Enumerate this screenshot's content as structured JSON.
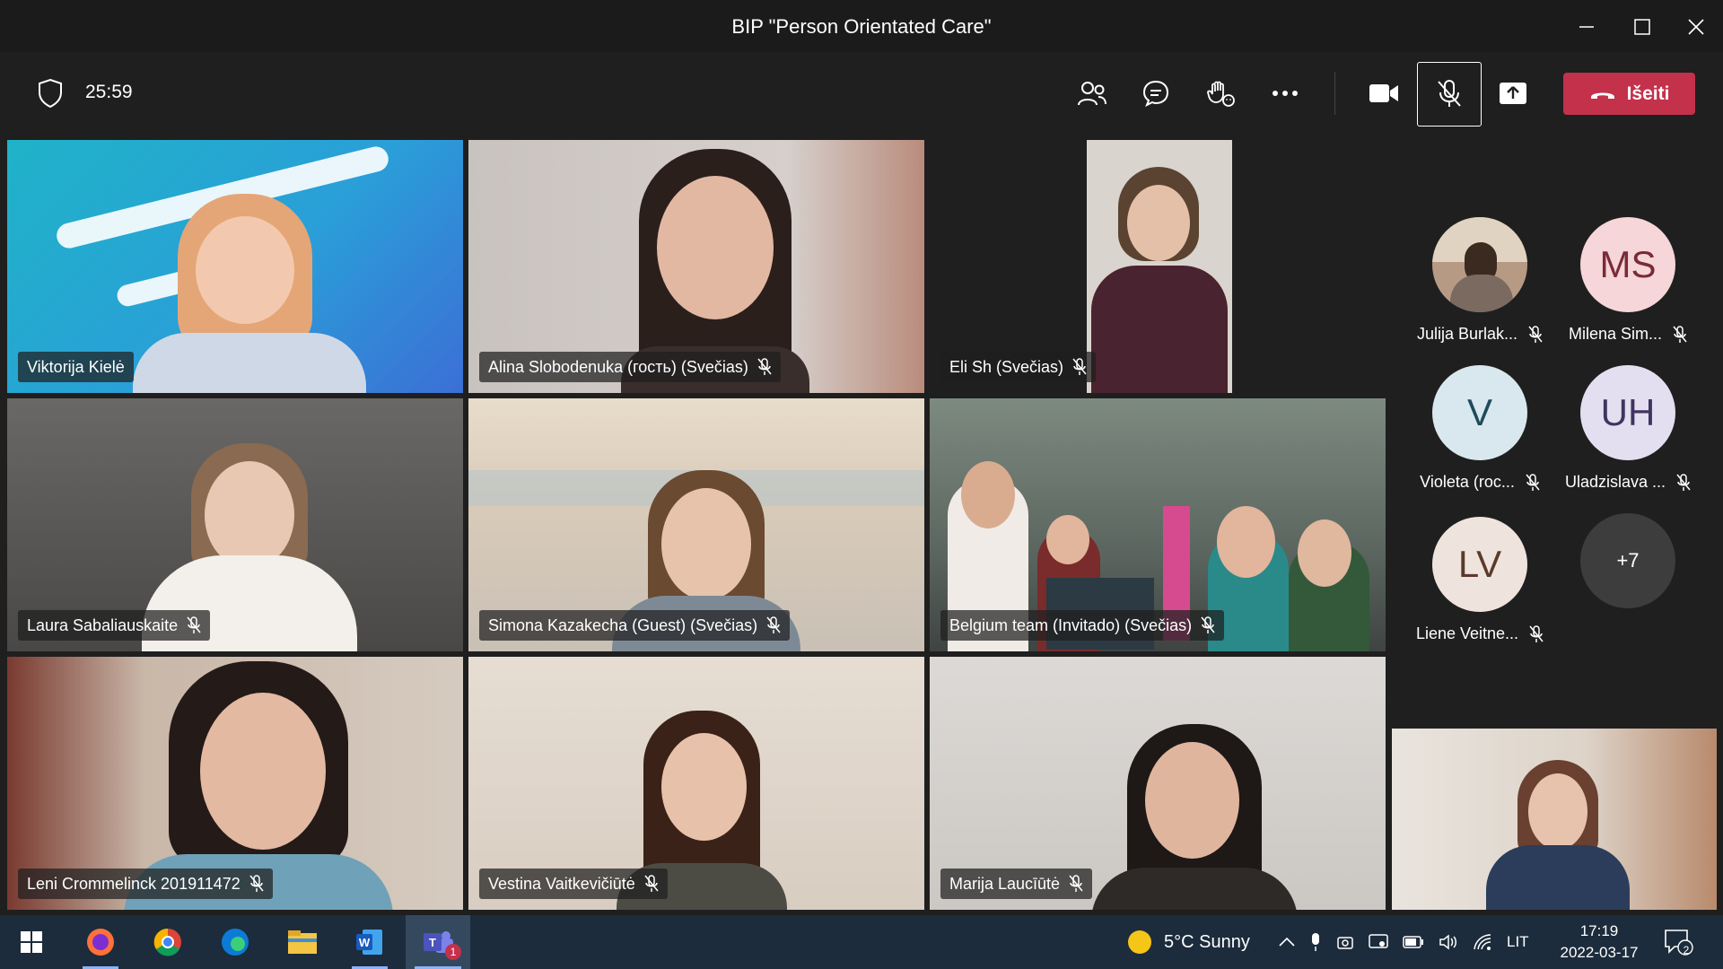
{
  "window": {
    "title": "BIP \"Person Orientated Care\""
  },
  "toolbar": {
    "timer": "25:59",
    "leave_label": "Išeiti",
    "icons": [
      "shield-icon",
      "people-icon",
      "chat-icon",
      "raise-hand-icon",
      "more-icon",
      "camera-icon",
      "mic-off-icon",
      "share-icon"
    ]
  },
  "tiles": [
    {
      "name": "Viktorija Kielė",
      "muted": false
    },
    {
      "name": "Alina Slobodenuka (гость) (Svečias)",
      "muted": true
    },
    {
      "name": "Eli Sh (Svečias)",
      "muted": true
    },
    {
      "name": "Laura Sabaliauskaite",
      "muted": true
    },
    {
      "name": "Simona Kazakecha (Guest) (Svečias)",
      "muted": true
    },
    {
      "name": "Belgium team (Invitado) (Svečias)",
      "muted": true
    },
    {
      "name": "Leni Crommelinck 201911472",
      "muted": true
    },
    {
      "name": "Vestina Vaitkevičiūtė",
      "muted": true
    },
    {
      "name": "Marija Laucīūtė",
      "muted": true
    }
  ],
  "roster": [
    {
      "initials": "",
      "name": "Julija Burlak...",
      "color": "#8a6d5a",
      "photo": true
    },
    {
      "initials": "MS",
      "name": "Milena Sim...",
      "color": "#f6d6d8",
      "text_color": "#7a2b36"
    },
    {
      "initials": "V",
      "name": "Violeta (roc...",
      "color": "#d8e8ee",
      "text_color": "#1f4b5a"
    },
    {
      "initials": "UH",
      "name": "Uladzislava ...",
      "color": "#e4dff0",
      "text_color": "#3f3560"
    },
    {
      "initials": "LV",
      "name": "Liene Veitne...",
      "color": "#efe3dd",
      "text_color": "#5a3a2c"
    }
  ],
  "overflow": "+7",
  "taskbar": {
    "weather": "5°C  Sunny",
    "language": "LIT",
    "time": "17:19",
    "date": "2022-03-17",
    "notifications": "2",
    "teams_badge": "1"
  }
}
